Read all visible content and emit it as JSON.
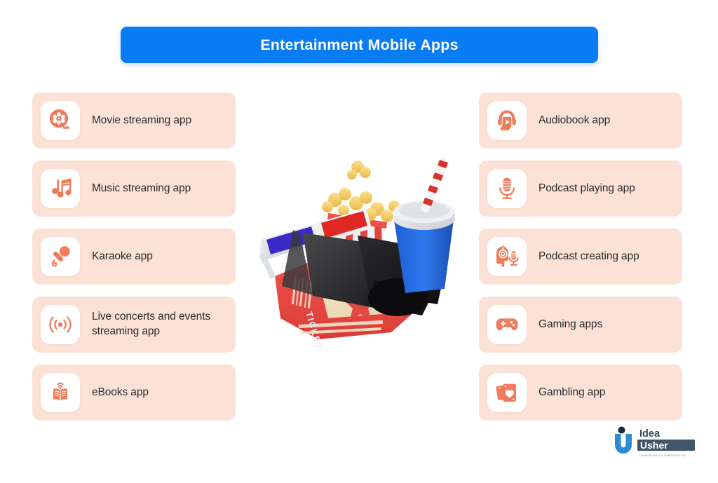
{
  "header": {
    "title": "Entertainment Mobile Apps",
    "banner_color": "#077CF5",
    "title_color": "#FFFFFF"
  },
  "theme": {
    "row_background": "#FCE2D6",
    "icon_color": "#F07B5B",
    "icon_tile_background": "#FFFFFF",
    "label_color": "#2B2B2E",
    "page_background": "#FFFFFF"
  },
  "left_column": {
    "items": [
      {
        "label": "Movie streaming app",
        "icon": "film-reel-icon"
      },
      {
        "label": "Music streaming app",
        "icon": "music-notes-icon"
      },
      {
        "label": "Karaoke app",
        "icon": "microphone-icon"
      },
      {
        "label": "Live concerts and events streaming app",
        "icon": "broadcast-waves-icon"
      },
      {
        "label": "eBooks app",
        "icon": "open-book-wifi-icon"
      }
    ]
  },
  "right_column": {
    "items": [
      {
        "label": "Audiobook app",
        "icon": "headphones-play-book-icon"
      },
      {
        "label": "Podcast playing app",
        "icon": "studio-microphone-icon"
      },
      {
        "label": "Podcast creating app",
        "icon": "head-headphones-mic-icon"
      },
      {
        "label": "Gaming apps",
        "icon": "gamepad-icon"
      },
      {
        "label": "Gambling app",
        "icon": "playing-cards-heart-icon"
      }
    ]
  },
  "illustration": {
    "name": "cinema-3d-illustration",
    "elements": [
      "movie-ticket",
      "3d-glasses",
      "popcorn-bucket",
      "popcorn-kernels",
      "film-clapper",
      "soda-cup-with-straw"
    ],
    "ticket_text": "TICKET"
  },
  "logo": {
    "brand_line1": "Idea",
    "brand_line2": "Usher",
    "tagline": "USHERING IN INNOVATION",
    "mark": "u-logo-mark",
    "color": "#2E8BD6",
    "text_color": "#3A4A5C"
  }
}
